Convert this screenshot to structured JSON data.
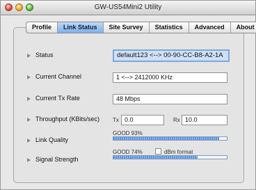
{
  "window": {
    "title": "GW-US54Mini2 Utility"
  },
  "tabs": [
    {
      "label": "Profile"
    },
    {
      "label": "Link Status"
    },
    {
      "label": "Site Survey"
    },
    {
      "label": "Statistics"
    },
    {
      "label": "Advanced"
    },
    {
      "label": "About"
    }
  ],
  "active_tab": "Link Status",
  "status": {
    "label": "Status",
    "value": "default123 <--> 00-90-CC-B8-A2-1A"
  },
  "channel": {
    "label": "Current Channel",
    "value": "1 <--> 2412000 KHz"
  },
  "tx_rate": {
    "label": "Current Tx Rate",
    "value": "48 Mbps"
  },
  "throughput": {
    "label": "Throughput (KBits/sec)",
    "tx_label": "Tx",
    "tx_value": "0.0",
    "rx_label": "Rx",
    "rx_value": "10.0"
  },
  "link_quality": {
    "label": "Link Quality",
    "text": "GOOD 93%",
    "level": 0.93
  },
  "signal_strength": {
    "label": "Signal Strength",
    "text": "GOOD 74%",
    "level": 0.74,
    "dbm_label": "dBm format",
    "dbm_checked": false
  },
  "colors": {
    "active_tab": "#7fb0e8",
    "bar_fill": "#5d93dd"
  }
}
